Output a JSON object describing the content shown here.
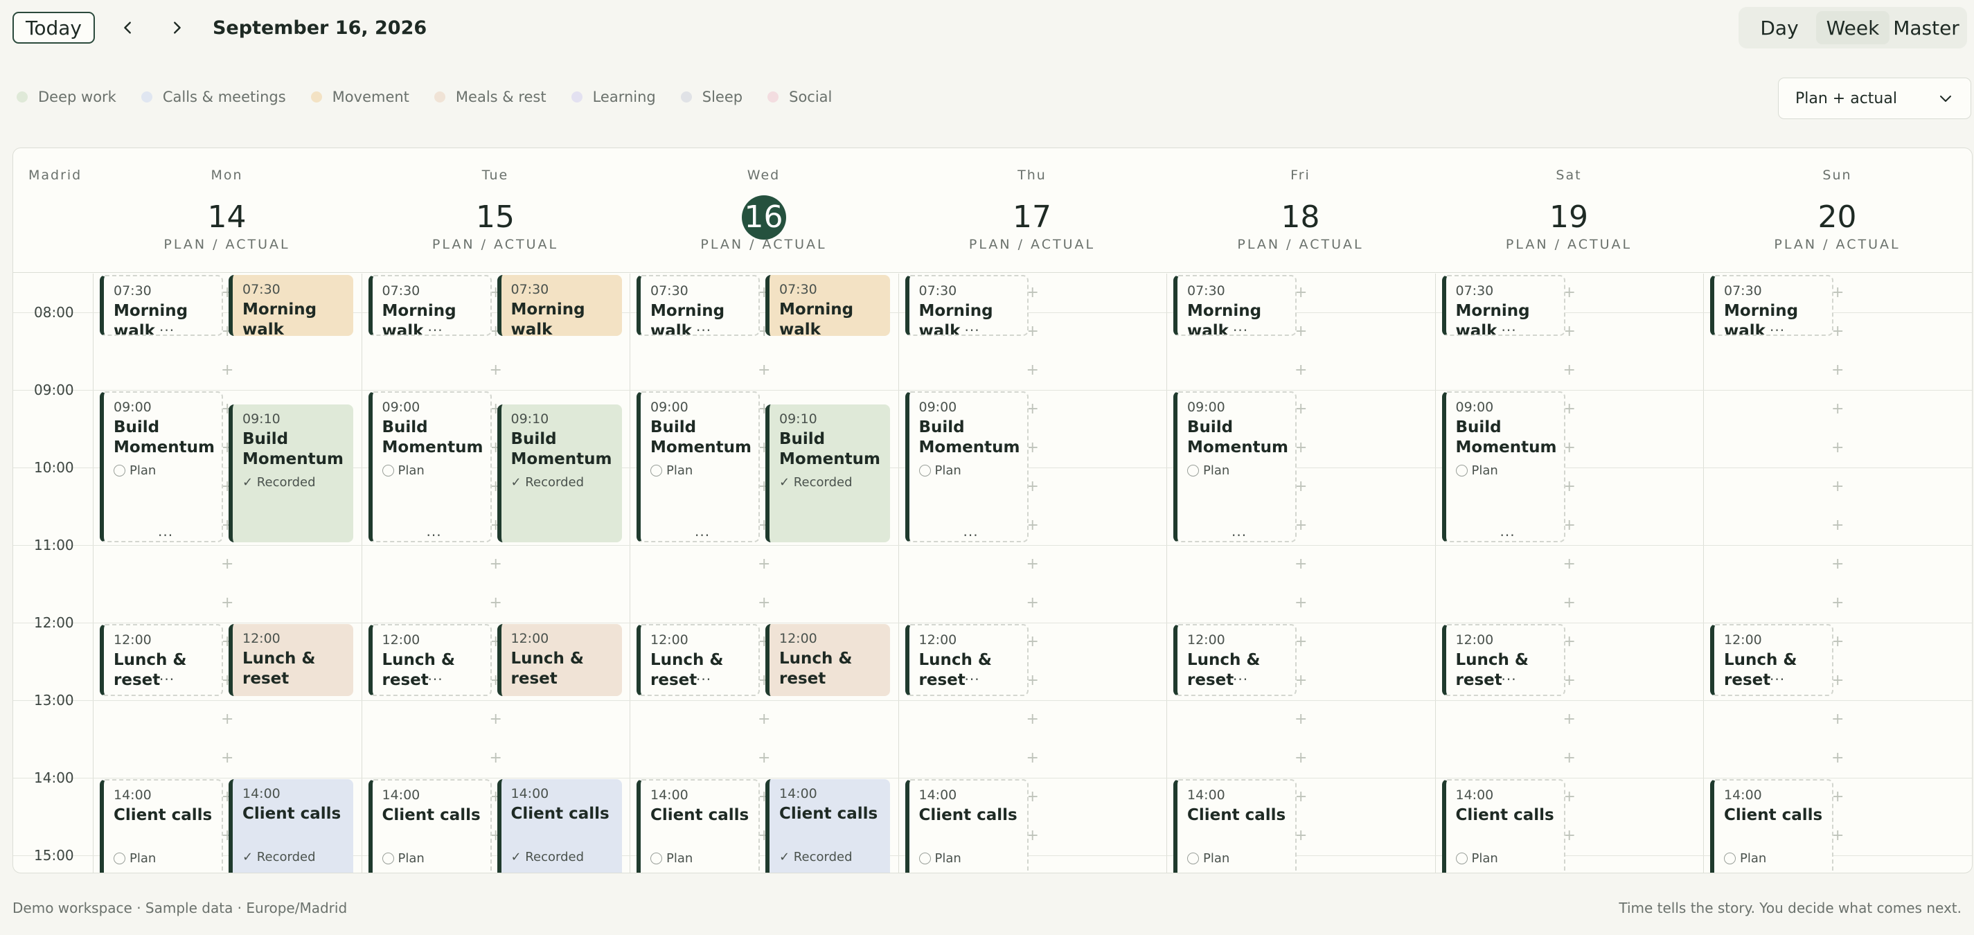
{
  "toolbar": {
    "today_label": "Today",
    "date_title": "September 16, 2026",
    "views": [
      {
        "label": "Day",
        "active": false
      },
      {
        "label": "Week",
        "active": true
      },
      {
        "label": "Master",
        "active": false
      }
    ],
    "mode_select_value": "Plan + actual"
  },
  "legend": [
    {
      "label": "Deep work",
      "color": "#dfe9d8"
    },
    {
      "label": "Calls & meetings",
      "color": "#e0e6f1"
    },
    {
      "label": "Movement",
      "color": "#f3e2c4"
    },
    {
      "label": "Meals & rest",
      "color": "#f0e3d6"
    },
    {
      "label": "Learning",
      "color": "#e3e1f1"
    },
    {
      "label": "Sleep",
      "color": "#e0e2e6"
    },
    {
      "label": "Social",
      "color": "#f3dde0"
    }
  ],
  "calendar": {
    "timezone": "Madrid",
    "plan_actual_label": "PLAN / ACTUAL",
    "days": [
      {
        "name": "Mon",
        "num": "14",
        "today": false
      },
      {
        "name": "Tue",
        "num": "15",
        "today": false
      },
      {
        "name": "Wed",
        "num": "16",
        "today": true
      },
      {
        "name": "Thu",
        "num": "17",
        "today": false
      },
      {
        "name": "Fri",
        "num": "18",
        "today": false
      },
      {
        "name": "Sat",
        "num": "19",
        "today": false
      },
      {
        "name": "Sun",
        "num": "20",
        "today": false
      }
    ],
    "hours": [
      "08:00",
      "09:00",
      "10:00",
      "11:00",
      "12:00",
      "13:00",
      "14:00",
      "15:00"
    ],
    "events": [
      {
        "day": 0,
        "kind": "plan",
        "time": "07:30",
        "title": "Morning walk",
        "category": "Movement"
      },
      {
        "day": 0,
        "kind": "actual",
        "time": "07:30",
        "title": "Morning walk",
        "category": "Movement"
      },
      {
        "day": 0,
        "kind": "plan",
        "time": "09:00",
        "title": "Build Momentum",
        "status": "Plan",
        "category": "Deep work"
      },
      {
        "day": 0,
        "kind": "actual",
        "time": "09:10",
        "title": "Build Momentum",
        "status": "✓ Recorded",
        "category": "Deep work"
      },
      {
        "day": 0,
        "kind": "plan",
        "time": "12:00",
        "title": "Lunch & reset",
        "category": "Meals & rest"
      },
      {
        "day": 0,
        "kind": "actual",
        "time": "12:00",
        "title": "Lunch & reset",
        "category": "Meals & rest"
      },
      {
        "day": 0,
        "kind": "plan",
        "time": "14:00",
        "title": "Client calls",
        "status": "Plan",
        "category": "Calls & meetings"
      },
      {
        "day": 0,
        "kind": "actual",
        "time": "14:00",
        "title": "Client calls",
        "status": "✓ Recorded",
        "category": "Calls & meetings"
      },
      {
        "day": 1,
        "kind": "plan",
        "time": "07:30",
        "title": "Morning walk",
        "category": "Movement"
      },
      {
        "day": 1,
        "kind": "actual",
        "time": "07:30",
        "title": "Morning walk",
        "category": "Movement"
      },
      {
        "day": 1,
        "kind": "plan",
        "time": "09:00",
        "title": "Build Momentum",
        "status": "Plan",
        "category": "Deep work"
      },
      {
        "day": 1,
        "kind": "actual",
        "time": "09:10",
        "title": "Build Momentum",
        "status": "✓ Recorded",
        "category": "Deep work"
      },
      {
        "day": 1,
        "kind": "plan",
        "time": "12:00",
        "title": "Lunch & reset",
        "category": "Meals & rest"
      },
      {
        "day": 1,
        "kind": "actual",
        "time": "12:00",
        "title": "Lunch & reset",
        "category": "Meals & rest"
      },
      {
        "day": 1,
        "kind": "plan",
        "time": "14:00",
        "title": "Client calls",
        "status": "Plan",
        "category": "Calls & meetings"
      },
      {
        "day": 1,
        "kind": "actual",
        "time": "14:00",
        "title": "Client calls",
        "status": "✓ Recorded",
        "category": "Calls & meetings"
      },
      {
        "day": 2,
        "kind": "plan",
        "time": "07:30",
        "title": "Morning walk",
        "category": "Movement"
      },
      {
        "day": 2,
        "kind": "actual",
        "time": "07:30",
        "title": "Morning walk",
        "category": "Movement"
      },
      {
        "day": 2,
        "kind": "plan",
        "time": "09:00",
        "title": "Build Momentum",
        "status": "Plan",
        "category": "Deep work"
      },
      {
        "day": 2,
        "kind": "actual",
        "time": "09:10",
        "title": "Build Momentum",
        "status": "✓ Recorded",
        "category": "Deep work"
      },
      {
        "day": 2,
        "kind": "plan",
        "time": "12:00",
        "title": "Lunch & reset",
        "category": "Meals & rest"
      },
      {
        "day": 2,
        "kind": "actual",
        "time": "12:00",
        "title": "Lunch & reset",
        "category": "Meals & rest"
      },
      {
        "day": 2,
        "kind": "plan",
        "time": "14:00",
        "title": "Client calls",
        "status": "Plan",
        "category": "Calls & meetings"
      },
      {
        "day": 2,
        "kind": "actual",
        "time": "14:00",
        "title": "Client calls",
        "status": "✓ Recorded",
        "category": "Calls & meetings"
      },
      {
        "day": 3,
        "kind": "plan",
        "time": "07:30",
        "title": "Morning walk",
        "category": "Movement"
      },
      {
        "day": 3,
        "kind": "plan",
        "time": "09:00",
        "title": "Build Momentum",
        "status": "Plan",
        "category": "Deep work"
      },
      {
        "day": 3,
        "kind": "plan",
        "time": "12:00",
        "title": "Lunch & reset",
        "category": "Meals & rest"
      },
      {
        "day": 3,
        "kind": "plan",
        "time": "14:00",
        "title": "Client calls",
        "status": "Plan",
        "category": "Calls & meetings"
      },
      {
        "day": 4,
        "kind": "plan",
        "time": "07:30",
        "title": "Morning walk",
        "category": "Movement"
      },
      {
        "day": 4,
        "kind": "plan",
        "time": "09:00",
        "title": "Build Momentum",
        "status": "Plan",
        "category": "Deep work"
      },
      {
        "day": 4,
        "kind": "plan",
        "time": "12:00",
        "title": "Lunch & reset",
        "category": "Meals & rest"
      },
      {
        "day": 4,
        "kind": "plan",
        "time": "14:00",
        "title": "Client calls",
        "status": "Plan",
        "category": "Calls & meetings"
      },
      {
        "day": 5,
        "kind": "plan",
        "time": "07:30",
        "title": "Morning walk",
        "category": "Movement"
      },
      {
        "day": 5,
        "kind": "plan",
        "time": "09:00",
        "title": "Build Momentum",
        "status": "Plan",
        "category": "Deep work"
      },
      {
        "day": 5,
        "kind": "plan",
        "time": "12:00",
        "title": "Lunch & reset",
        "category": "Meals & rest"
      },
      {
        "day": 5,
        "kind": "plan",
        "time": "14:00",
        "title": "Client calls",
        "status": "Plan",
        "category": "Calls & meetings"
      },
      {
        "day": 6,
        "kind": "plan",
        "time": "07:30",
        "title": "Morning walk",
        "category": "Movement"
      },
      {
        "day": 6,
        "kind": "plan",
        "time": "12:00",
        "title": "Lunch & reset",
        "category": "Meals & rest"
      },
      {
        "day": 6,
        "kind": "plan",
        "time": "14:00",
        "title": "Client calls",
        "status": "Plan",
        "category": "Calls & meetings"
      }
    ]
  },
  "footer": {
    "left": "Demo workspace · Sample data · Europe/Madrid",
    "right": "Time tells the story. You decide what comes next."
  },
  "icons": {
    "prev": "chevron-left-icon",
    "next": "chevron-right-icon",
    "dropdown": "chevron-down-icon",
    "add": "plus-icon"
  }
}
